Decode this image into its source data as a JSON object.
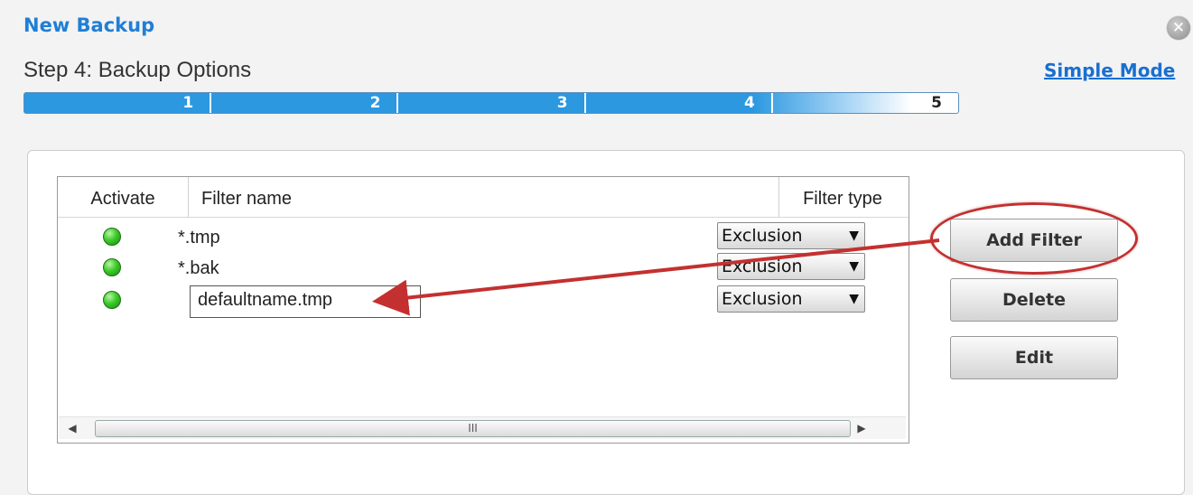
{
  "dialog": {
    "title": "New Backup",
    "step_title": "Step 4: Backup Options",
    "simple_mode_link": "Simple Mode"
  },
  "progress": {
    "steps": [
      "1",
      "2",
      "3",
      "4",
      "5"
    ],
    "current_step": 4
  },
  "filters_table": {
    "columns": [
      "Activate",
      "Filter name",
      "Filter type"
    ],
    "rows": [
      {
        "active": true,
        "name": "*.tmp",
        "type": "Exclusion"
      },
      {
        "active": true,
        "name": "*.bak",
        "type": "Exclusion"
      },
      {
        "active": true,
        "name": "defaultname.tmp",
        "type": "Exclusion",
        "editing": true
      }
    ]
  },
  "buttons": {
    "add_filter": "Add Filter",
    "delete": "Delete",
    "edit": "Edit"
  },
  "scrollbar": {
    "thumb_grip": "III"
  },
  "colors": {
    "title_blue": "#1f7fd6",
    "progress_blue": "#2b98e0",
    "annotation_red": "#c43030",
    "active_green": "#3ccb2a"
  },
  "icons": {
    "close": "close-circle-icon",
    "dropdown": "triangle-down-icon",
    "scroll_left": "triangle-left-icon",
    "scroll_right": "triangle-right-icon"
  }
}
